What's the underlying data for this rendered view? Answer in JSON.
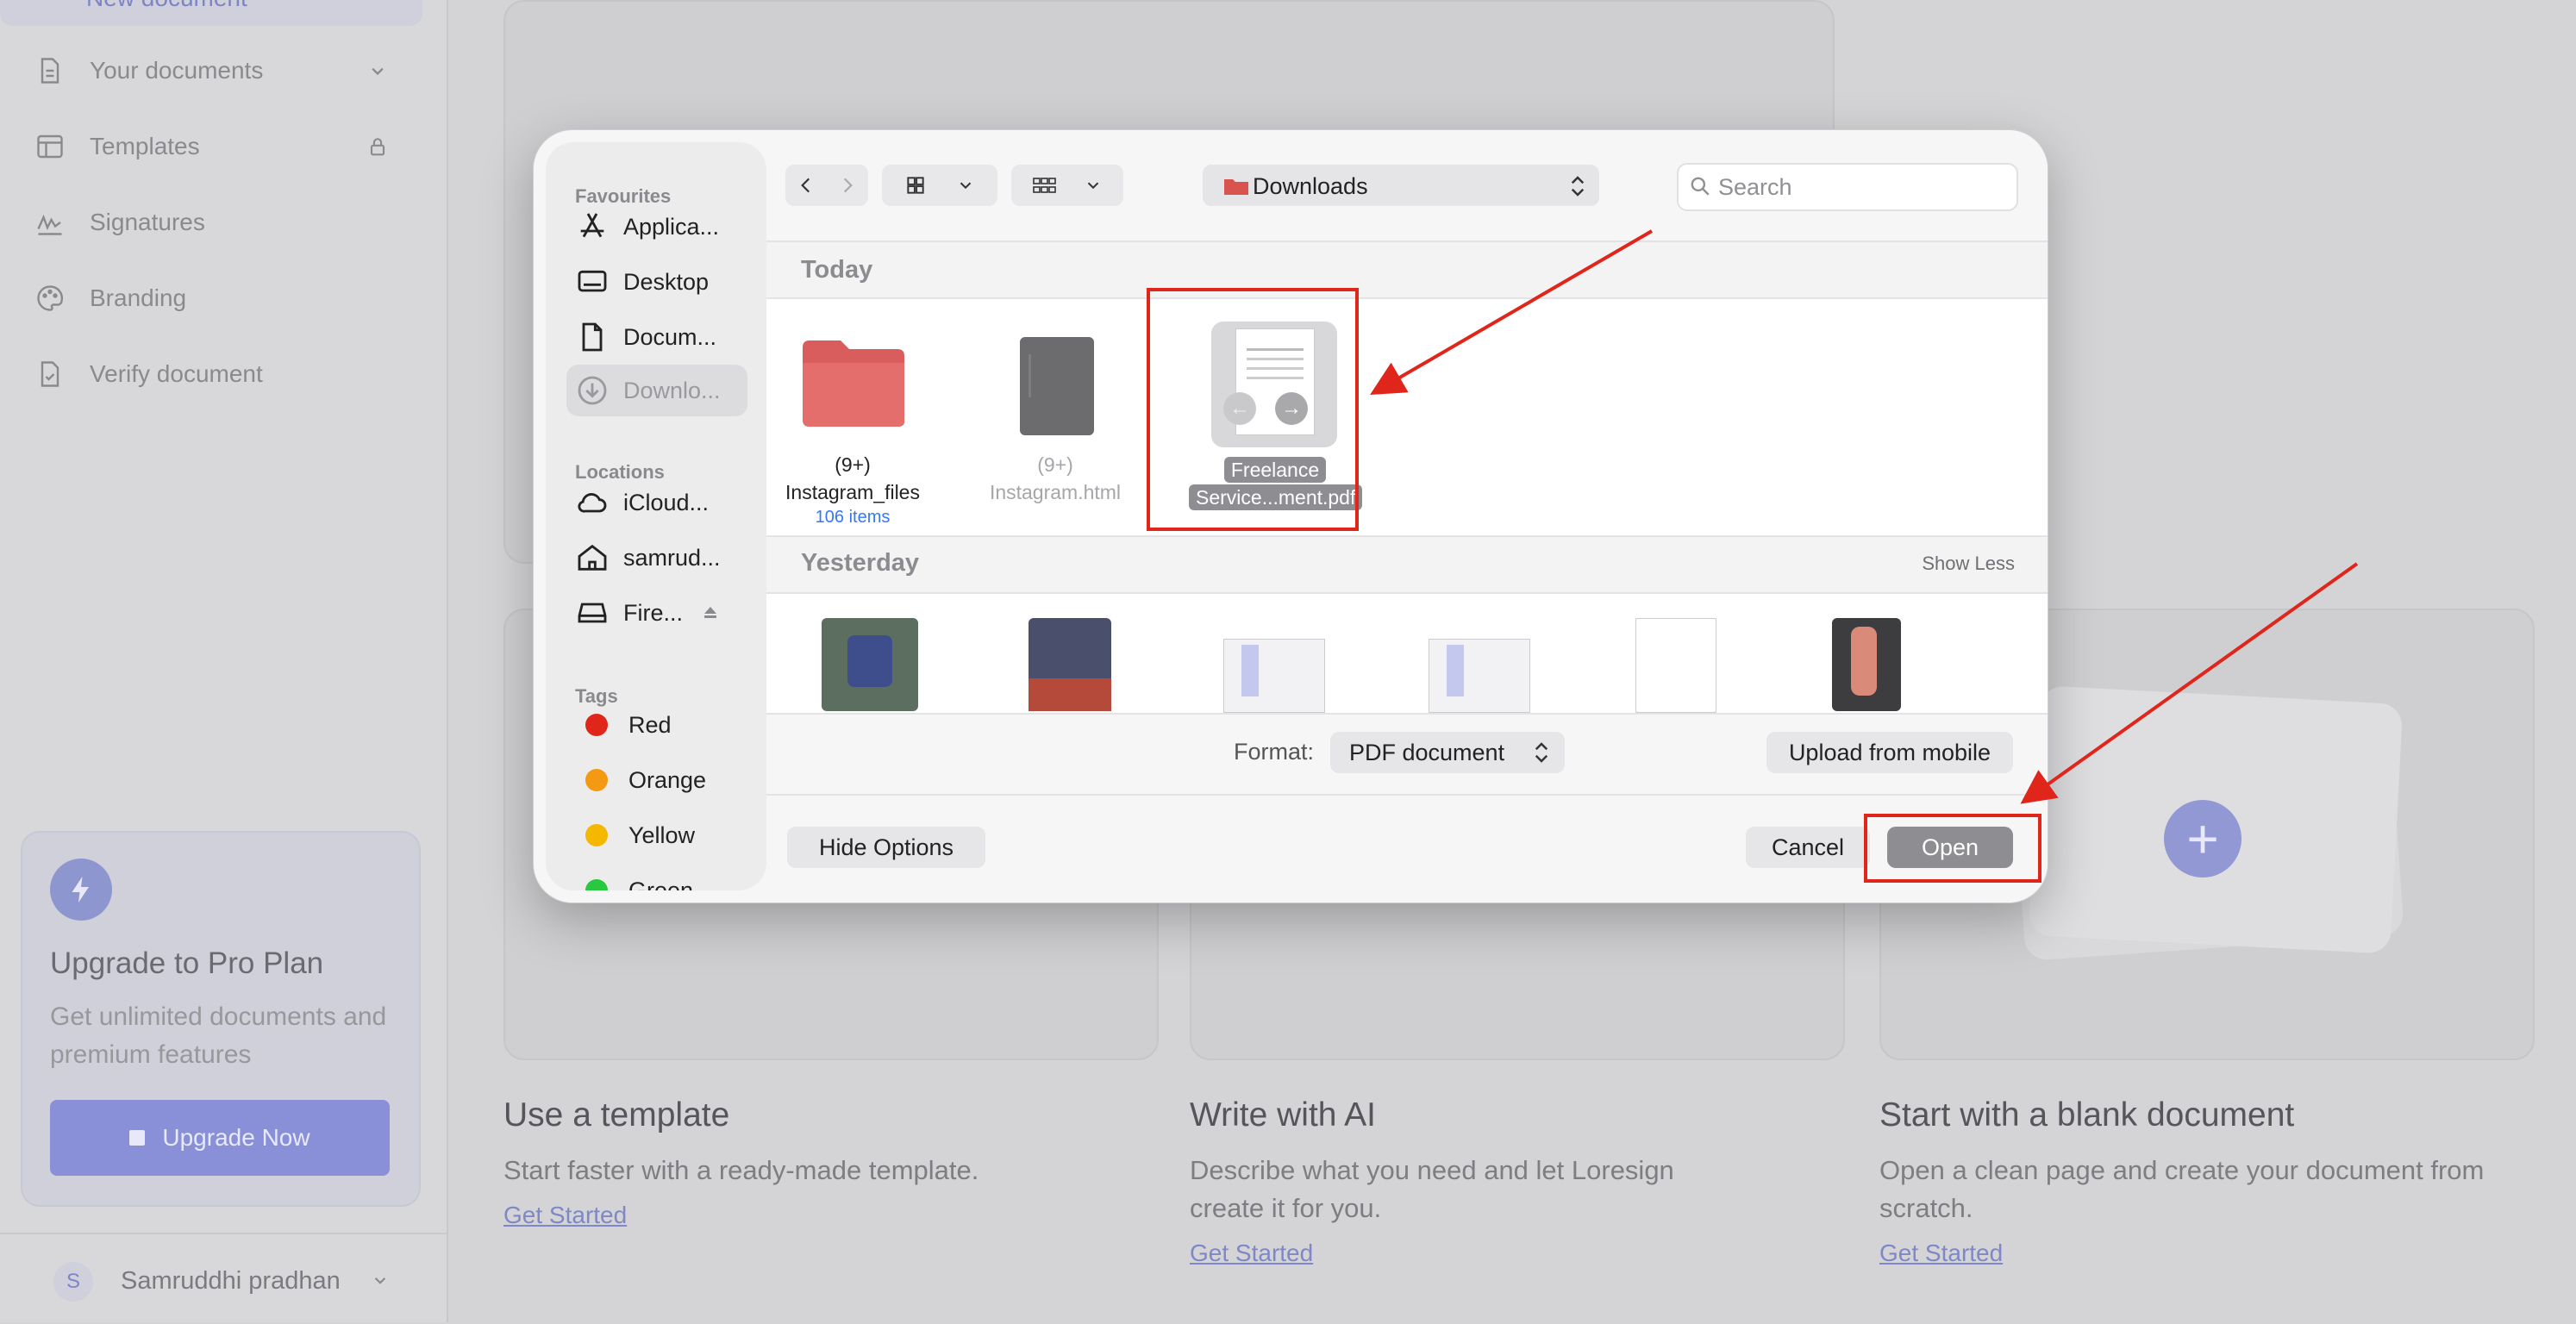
{
  "sidebar": {
    "new_document": "New document",
    "items": [
      {
        "label": "Your documents",
        "icon": "document-icon"
      },
      {
        "label": "Templates",
        "icon": "template-icon"
      },
      {
        "label": "Signatures",
        "icon": "signature-icon"
      },
      {
        "label": "Branding",
        "icon": "palette-icon"
      },
      {
        "label": "Verify document",
        "icon": "verify-document-icon"
      }
    ],
    "upgrade": {
      "title": "Upgrade to Pro Plan",
      "description": "Get unlimited documents and premium features",
      "button": "Upgrade Now"
    },
    "user": {
      "initial": "S",
      "name": "Samruddhi pradhan"
    }
  },
  "main": {
    "sections": [
      {
        "title": "Use a template",
        "description": "Start faster with a ready-made template.",
        "link": "Get Started"
      },
      {
        "title": "Write with AI",
        "description": "Describe what you need and let Loresign create it for you.",
        "link": "Get Started"
      },
      {
        "title": "Start with a blank document",
        "description": "Open a clean page and create your document from scratch.",
        "link": "Get Started"
      }
    ]
  },
  "dialog": {
    "sidebar": {
      "favourites_heading": "Favourites",
      "favourites": [
        "Applica...",
        "Desktop",
        "Docum...",
        "Downlo..."
      ],
      "locations_heading": "Locations",
      "locations": [
        "iCloud...",
        "samrud...",
        "Fire..."
      ],
      "tags_heading": "Tags",
      "tags": [
        {
          "label": "Red",
          "color": "#e0251b"
        },
        {
          "label": "Orange",
          "color": "#f39a12"
        },
        {
          "label": "Yellow",
          "color": "#f5b800"
        },
        {
          "label": "Green",
          "color": "#28c840"
        }
      ]
    },
    "location": "Downloads",
    "search_placeholder": "Search",
    "today_heading": "Today",
    "yesterday_heading": "Yesterday",
    "show_less": "Show Less",
    "today_files": [
      {
        "count_prefix": "(9+)",
        "name": "Instagram_files",
        "sub": "106 items"
      },
      {
        "count_prefix": "(9+)",
        "name": "Instagram.html"
      },
      {
        "name_line1": "Freelance",
        "name_line2": "Service...ment.pdf"
      }
    ],
    "format_label": "Format:",
    "format_value": "PDF document",
    "upload_mobile": "Upload from mobile",
    "hide_options": "Hide Options",
    "cancel": "Cancel",
    "open": "Open"
  },
  "colors": {
    "accent": "#8990d8",
    "annotation": "#e0251b",
    "primary_button": "#8e8e92"
  }
}
